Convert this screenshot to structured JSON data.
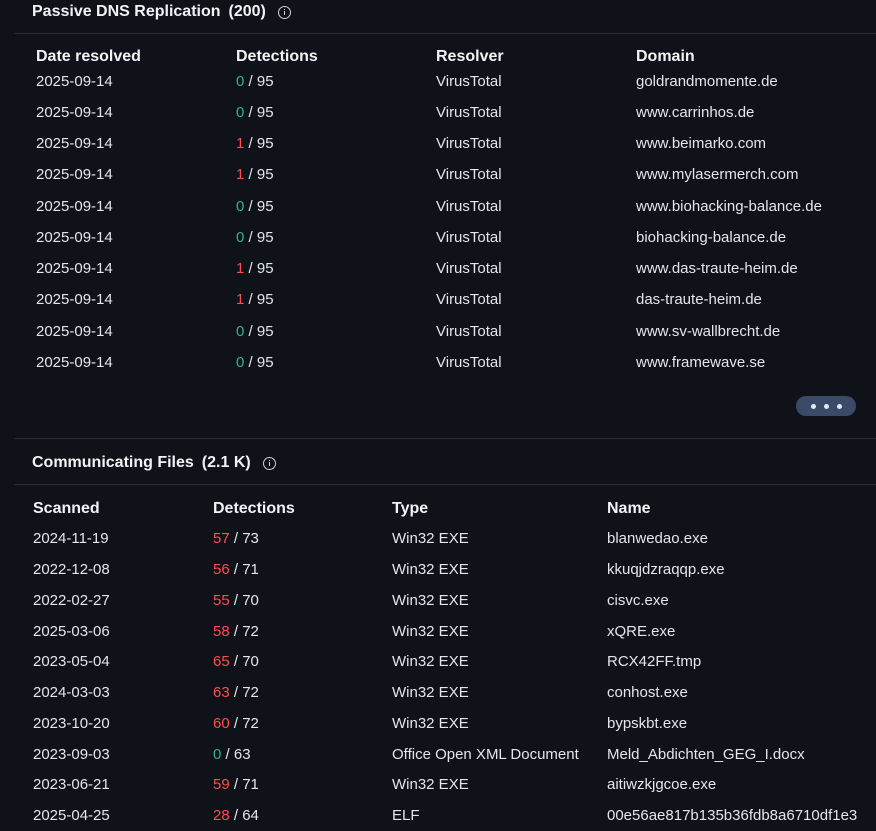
{
  "passive_dns": {
    "title": "Passive DNS Replication",
    "count": "(200)",
    "headers": [
      "Date resolved",
      "Detections",
      "Resolver",
      "Domain"
    ],
    "rows": [
      {
        "date": "2025-09-14",
        "det": "0",
        "total": "/ 95",
        "resolver": "VirusTotal",
        "domain": "goldrandmomente.de",
        "flag": "clean"
      },
      {
        "date": "2025-09-14",
        "det": "0",
        "total": "/ 95",
        "resolver": "VirusTotal",
        "domain": "www.carrinhos.de",
        "flag": "clean"
      },
      {
        "date": "2025-09-14",
        "det": "1",
        "total": "/ 95",
        "resolver": "VirusTotal",
        "domain": "www.beimarko.com",
        "flag": "bad"
      },
      {
        "date": "2025-09-14",
        "det": "1",
        "total": "/ 95",
        "resolver": "VirusTotal",
        "domain": "www.mylasermerch.com",
        "flag": "bad"
      },
      {
        "date": "2025-09-14",
        "det": "0",
        "total": "/ 95",
        "resolver": "VirusTotal",
        "domain": "www.biohacking-balance.de",
        "flag": "clean"
      },
      {
        "date": "2025-09-14",
        "det": "0",
        "total": "/ 95",
        "resolver": "VirusTotal",
        "domain": "biohacking-balance.de",
        "flag": "clean"
      },
      {
        "date": "2025-09-14",
        "det": "1",
        "total": "/ 95",
        "resolver": "VirusTotal",
        "domain": "www.das-traute-heim.de",
        "flag": "bad"
      },
      {
        "date": "2025-09-14",
        "det": "1",
        "total": "/ 95",
        "resolver": "VirusTotal",
        "domain": "das-traute-heim.de",
        "flag": "bad"
      },
      {
        "date": "2025-09-14",
        "det": "0",
        "total": "/ 95",
        "resolver": "VirusTotal",
        "domain": "www.sv-wallbrecht.de",
        "flag": "clean"
      },
      {
        "date": "2025-09-14",
        "det": "0",
        "total": "/ 95",
        "resolver": "VirusTotal",
        "domain": "www.framewave.se",
        "flag": "clean"
      }
    ],
    "more_icon": "ellipsis-icon"
  },
  "communicating_files": {
    "title": "Communicating Files",
    "count": "(2.1 K)",
    "headers": [
      "Scanned",
      "Detections",
      "Type",
      "Name"
    ],
    "rows": [
      {
        "date": "2024-11-19",
        "det": "57",
        "total": "/ 73",
        "type": "Win32 EXE",
        "name": "blanwedao.exe",
        "flag": "bad"
      },
      {
        "date": "2022-12-08",
        "det": "56",
        "total": "/ 71",
        "type": "Win32 EXE",
        "name": "kkuqjdzraqqp.exe",
        "flag": "bad"
      },
      {
        "date": "2022-02-27",
        "det": "55",
        "total": "/ 70",
        "type": "Win32 EXE",
        "name": "cisvc.exe",
        "flag": "bad"
      },
      {
        "date": "2025-03-06",
        "det": "58",
        "total": "/ 72",
        "type": "Win32 EXE",
        "name": "xQRE.exe",
        "flag": "bad"
      },
      {
        "date": "2023-05-04",
        "det": "65",
        "total": "/ 70",
        "type": "Win32 EXE",
        "name": "RCX42FF.tmp",
        "flag": "bad"
      },
      {
        "date": "2024-03-03",
        "det": "63",
        "total": "/ 72",
        "type": "Win32 EXE",
        "name": "conhost.exe",
        "flag": "bad"
      },
      {
        "date": "2023-10-20",
        "det": "60",
        "total": "/ 72",
        "type": "Win32 EXE",
        "name": "bypskbt.exe",
        "flag": "bad"
      },
      {
        "date": "2023-09-03",
        "det": "0",
        "total": "/ 63",
        "type": "Office Open XML Document",
        "name": "Meld_Abdichten_GEG_I.docx",
        "flag": "clean"
      },
      {
        "date": "2023-06-21",
        "det": "59",
        "total": "/ 71",
        "type": "Win32 EXE",
        "name": "aitiwzkjgcoe.exe",
        "flag": "bad"
      },
      {
        "date": "2025-04-25",
        "det": "28",
        "total": "/ 64",
        "type": "ELF",
        "name": "00e56ae817b135b36fdb8a6710df1e3",
        "flag": "bad"
      }
    ]
  },
  "colors": {
    "background": "#0f1218",
    "clean": "#32b38a",
    "malicious": "#ff4d4d",
    "more_button": "#3b4a66"
  }
}
